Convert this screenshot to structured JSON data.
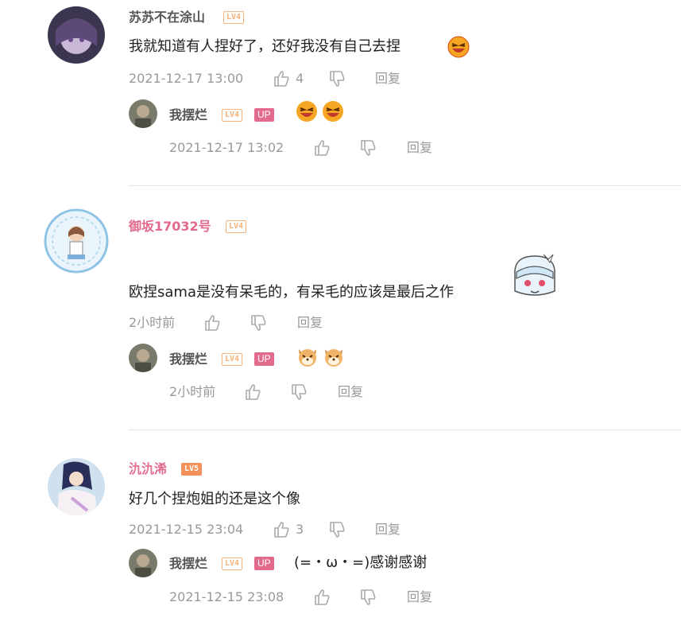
{
  "comments": [
    {
      "user": "苏苏不在涂山",
      "level": "LV4",
      "text": "我就知道有人捏好了，还好我没有自己去捏",
      "time": "2021-12-17 13:00",
      "likes": "4",
      "reply_label": "回复",
      "reply": {
        "user": "我摆烂",
        "level": "LV4",
        "badge": "UP",
        "text": "",
        "time": "2021-12-17 13:02",
        "reply_label": "回复"
      }
    },
    {
      "user": "御坂17032号",
      "level": "LV4",
      "text": "欧捏sama是没有呆毛的，有呆毛的应该是最后之作",
      "time": "2小时前",
      "likes": "",
      "reply_label": "回复",
      "reply": {
        "user": "我摆烂",
        "level": "LV4",
        "badge": "UP",
        "text": "",
        "time": "2小时前",
        "reply_label": "回复"
      }
    },
    {
      "user": "氿氿浠",
      "level": "LV5",
      "text": "好几个捏炮姐的还是这个像",
      "time": "2021-12-15 23:04",
      "likes": "3",
      "reply_label": "回复",
      "reply": {
        "user": "我摆烂",
        "level": "LV4",
        "badge": "UP",
        "text": "(=・ω・=)感谢感谢",
        "time": "2021-12-15 23:08",
        "reply_label": "回复"
      }
    }
  ]
}
